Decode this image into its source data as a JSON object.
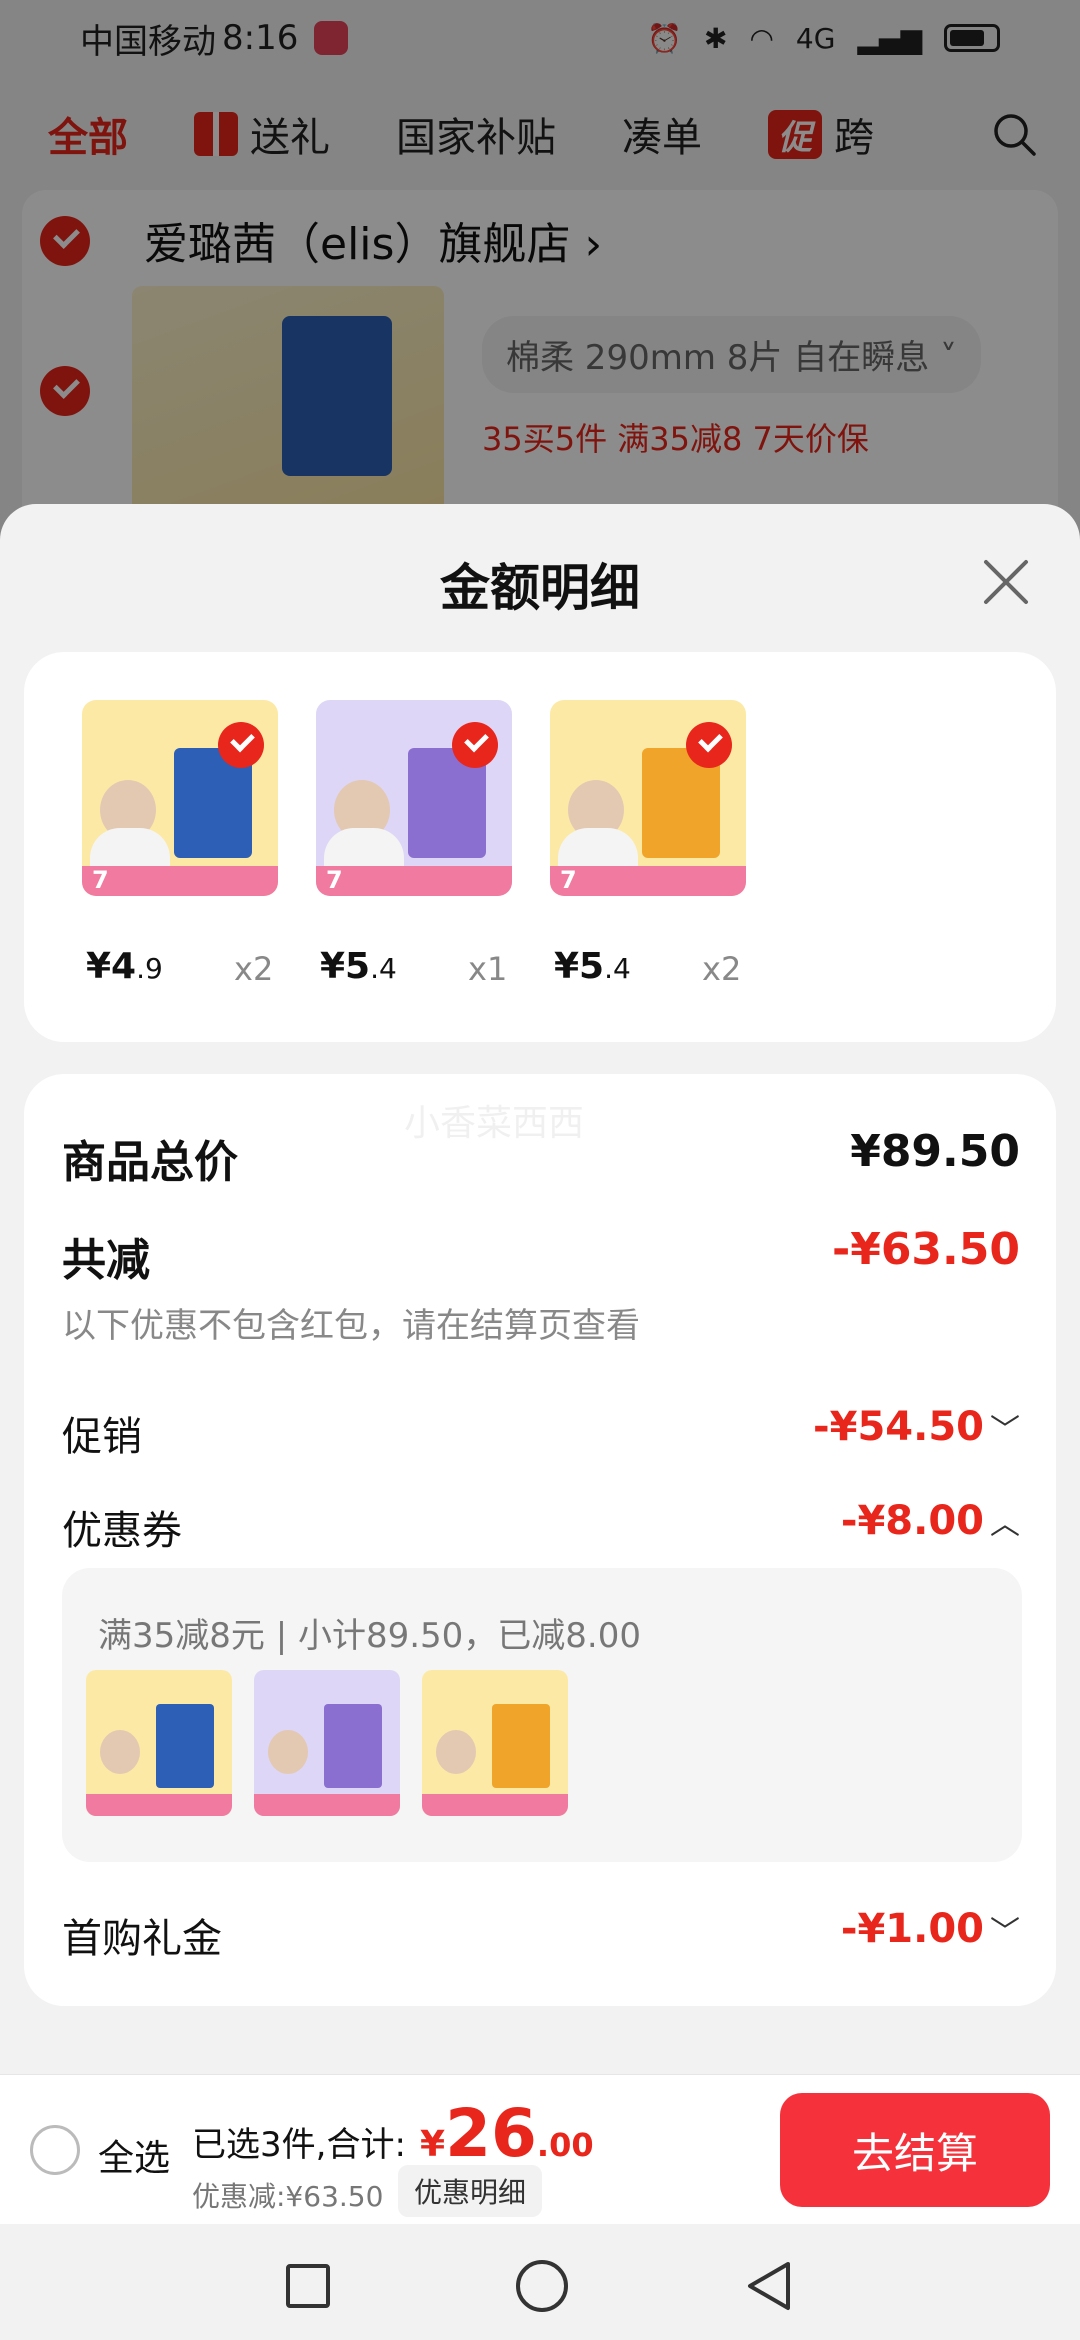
{
  "status_bar": {
    "carrier": "中国移动",
    "time": "8:16",
    "network": "4G"
  },
  "tabs": [
    {
      "label": "全部"
    },
    {
      "label": "送礼"
    },
    {
      "label": "国家补贴"
    },
    {
      "label": "凑单"
    },
    {
      "label": "促",
      "tag": true
    },
    {
      "label": "跨"
    }
  ],
  "store": {
    "name": "爱璐茜（elis）旗舰店",
    "sku": "棉柔 290mm 8片 自在瞬息",
    "promos": "35买5件  满35减8  7天价保"
  },
  "sheet": {
    "title": "金额明细",
    "products": [
      {
        "price_int": "¥4",
        "price_dec": ".9",
        "qty": "x2",
        "pkg_color": "#2c5fb5",
        "bg": "#fde9a6"
      },
      {
        "price_int": "¥5",
        "price_dec": ".4",
        "qty": "x1",
        "pkg_color": "#8a6fd1",
        "bg": "#ddd6f6"
      },
      {
        "price_int": "¥5",
        "price_dec": ".4",
        "qty": "x2",
        "pkg_color": "#f0a52a",
        "bg": "#fde9a6"
      }
    ],
    "watermark": "小香菜西西",
    "total_label": "商品总价",
    "total_value": "¥89.50",
    "reduce_label": "共减",
    "reduce_value": "-¥63.50",
    "reduce_note": "以下优惠不包含红包，请在结算页查看",
    "promo_label": "促销",
    "promo_value": "-¥54.50",
    "coupon_label": "优惠券",
    "coupon_value": "-¥8.00",
    "coupon_detail": "满35减8元 | 小计89.50，已减8.00",
    "gift_label": "首购礼金",
    "gift_value": "-¥1.00"
  },
  "bottom_bar": {
    "select_all": "全选",
    "selected_text": "已选3件,合计:",
    "total_yen": "¥",
    "total_int": "26",
    "total_dec": ".00",
    "discount_text": "优惠减:¥63.50",
    "detail_button": "优惠明细",
    "checkout_button": "去结算"
  },
  "colors": {
    "accent": "#e8261b",
    "checkout": "#f5323c"
  }
}
